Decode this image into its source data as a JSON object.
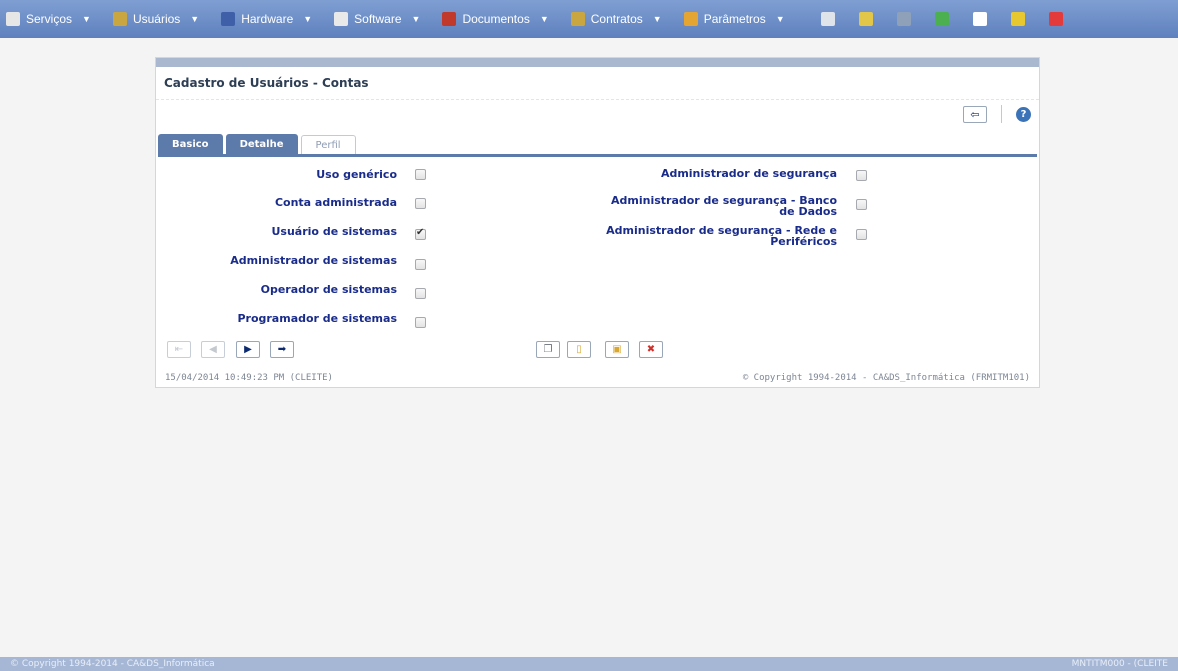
{
  "menu": {
    "items": [
      {
        "label": "Serviços",
        "icon": "services-icon",
        "color": "#e6e6e6"
      },
      {
        "label": "Usuários",
        "icon": "users-icon",
        "color": "#c9a640"
      },
      {
        "label": "Hardware",
        "icon": "hardware-icon",
        "color": "#3f5fa8"
      },
      {
        "label": "Software",
        "icon": "software-icon",
        "color": "#e9e9e9"
      },
      {
        "label": "Documentos",
        "icon": "documents-icon",
        "color": "#c0392b"
      },
      {
        "label": "Contratos",
        "icon": "contracts-icon",
        "color": "#c9a640"
      },
      {
        "label": "Parâmetros",
        "icon": "parameters-icon",
        "color": "#e5a532"
      }
    ],
    "tools": [
      {
        "icon": "camera-icon",
        "color": "#dfe3ea"
      },
      {
        "icon": "pencil-icon",
        "color": "#e1c64a"
      },
      {
        "icon": "gear-icon",
        "color": "#8fa0b9"
      },
      {
        "icon": "add-document-icon",
        "color": "#4caf50"
      },
      {
        "icon": "search-icon",
        "color": "#ffffff"
      },
      {
        "icon": "battery-icon",
        "color": "#e7c82f"
      },
      {
        "icon": "close-icon",
        "color": "#e33b3b"
      }
    ]
  },
  "panel": {
    "title": "Cadastro de Usuários - Contas",
    "back_label": "⇦",
    "help_label": "?"
  },
  "tabs": [
    {
      "label": "Basico"
    },
    {
      "label": "Detalhe"
    },
    {
      "label": "Perfil"
    }
  ],
  "left_fields": [
    {
      "label": "Uso genérico",
      "checked": false
    },
    {
      "label": "Conta administrada",
      "checked": false
    },
    {
      "label": "Usuário de sistemas",
      "checked": true
    },
    {
      "label": "Administrador de sistemas",
      "checked": false
    },
    {
      "label": "Operador de sistemas",
      "checked": false
    },
    {
      "label": "Programador de sistemas",
      "checked": false
    }
  ],
  "right_fields": [
    {
      "label": "Administrador de segurança",
      "checked": false
    },
    {
      "label": "Administrador de segurança - Banco de Dados",
      "checked": false
    },
    {
      "label": "Administrador de segurança - Rede e Periféricos",
      "checked": false
    }
  ],
  "nav_buttons": [
    {
      "glyph": "⇤",
      "state": "disabled"
    },
    {
      "glyph": "◀",
      "state": "disabled"
    },
    {
      "glyph": "▶",
      "state": "active"
    },
    {
      "glyph": "➡",
      "state": "active"
    }
  ],
  "action_buttons": [
    {
      "icon": "copy-icon",
      "glyph": "❐",
      "color": "#6a6f78"
    },
    {
      "icon": "new-document-icon",
      "glyph": "▯",
      "color": "#d9a72f"
    },
    {
      "icon": "save-icon",
      "glyph": "▣",
      "color": "#d9a72f"
    },
    {
      "icon": "delete-icon",
      "glyph": "✖",
      "color": "#d0302a"
    }
  ],
  "status": {
    "timestamp": "15/04/2014  10:49:23 PM (CLEITE)",
    "copyright": "© Copyright 1994-2014 - CA&DS_Informática (FRMITM101)"
  },
  "footer": {
    "left": "© Copyright 1994-2014 - CA&DS_Informática",
    "right": "MNTITM000 - (CLEITE"
  }
}
